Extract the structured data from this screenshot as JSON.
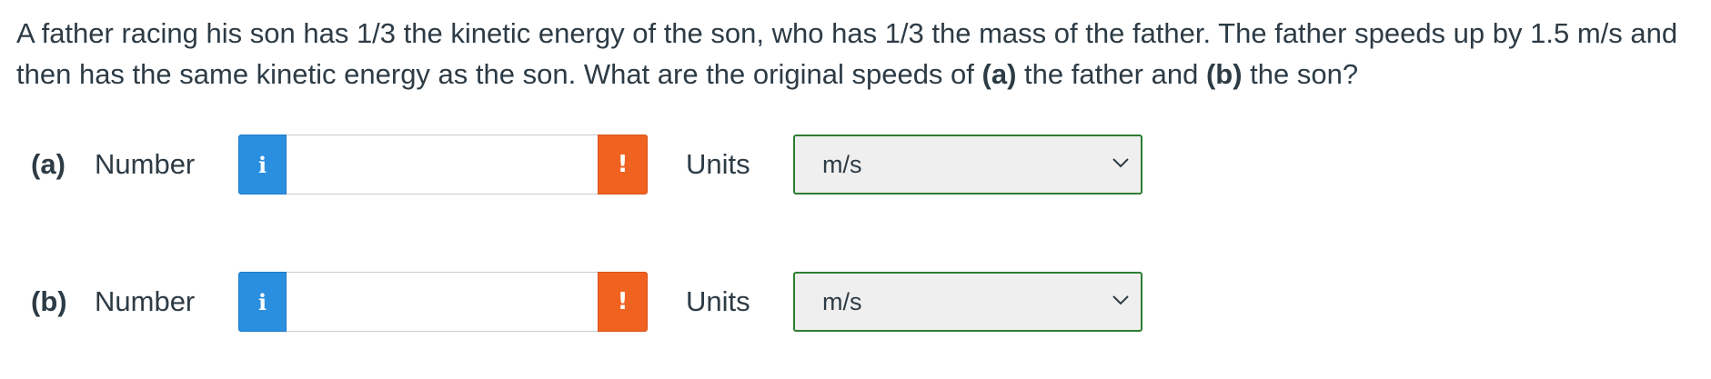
{
  "question": {
    "part1": "A father racing his son has 1/3 the kinetic energy of the son, who has 1/3 the mass of the father. The father speeds up by 1.5 m/s and then has the same kinetic energy as the son. What are the original speeds of ",
    "a_marker": "(a)",
    "part2": " the father and ",
    "b_marker": "(b)",
    "part3": " the son?"
  },
  "answers": [
    {
      "part": "(a)",
      "number_label": "Number",
      "info_icon": "i",
      "value": "",
      "warning_icon": "!",
      "units_label": "Units",
      "units_value": "m/s"
    },
    {
      "part": "(b)",
      "number_label": "Number",
      "info_icon": "i",
      "value": "",
      "warning_icon": "!",
      "units_label": "Units",
      "units_value": "m/s"
    }
  ],
  "colors": {
    "info": "#2b8fe0",
    "warning": "#f0621f",
    "select_border": "#2e7d32",
    "text": "#2d3b45"
  }
}
